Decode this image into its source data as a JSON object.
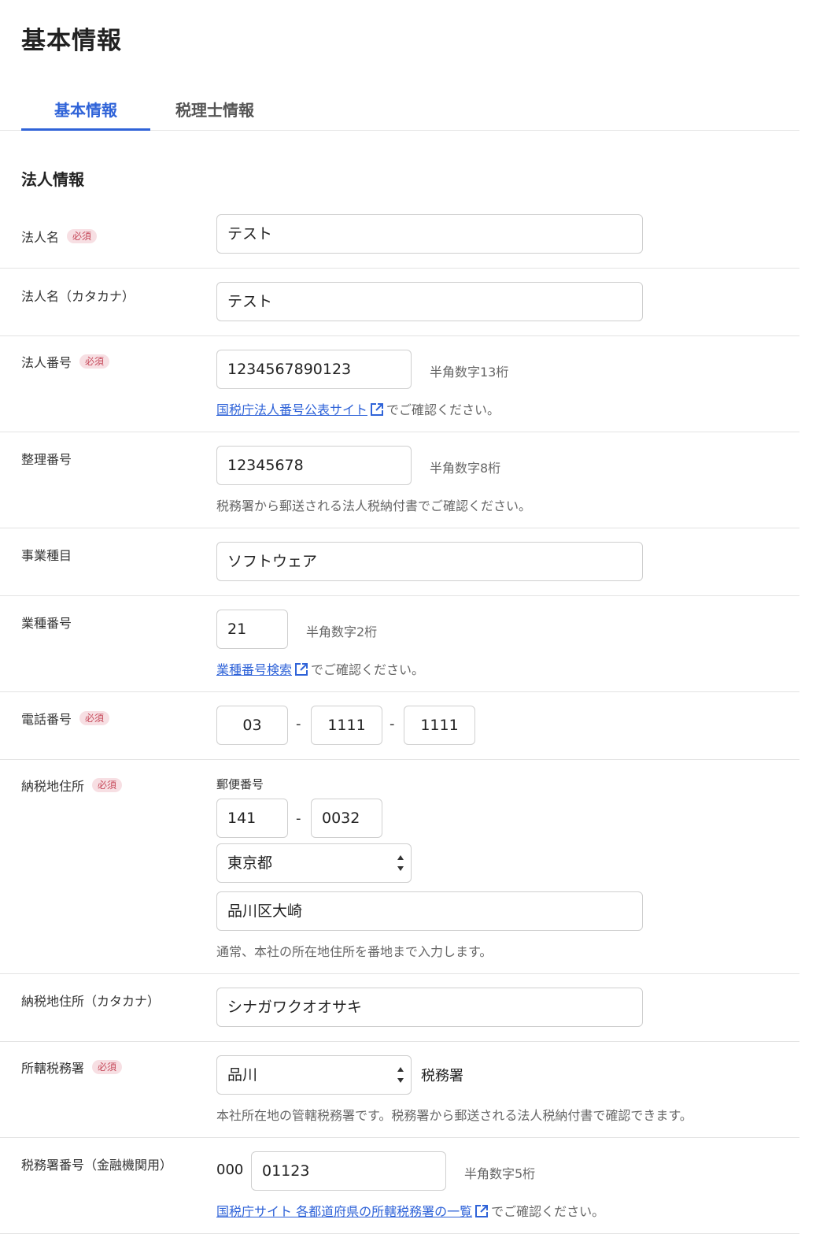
{
  "page": {
    "title": "基本情報"
  },
  "tabs": [
    {
      "label": "基本情報",
      "active": true
    },
    {
      "label": "税理士情報",
      "active": false
    }
  ],
  "section": {
    "title": "法人情報"
  },
  "required_badge": "必須",
  "fields": {
    "corp_name": {
      "label": "法人名",
      "value": "テスト"
    },
    "corp_name_kana": {
      "label": "法人名（カタカナ）",
      "value": "テスト"
    },
    "corp_number": {
      "label": "法人番号",
      "value": "1234567890123",
      "hint": "半角数字13桁",
      "note_link": "国税庁法人番号公表サイト",
      "note_text": "でご確認ください。"
    },
    "ref_number": {
      "label": "整理番号",
      "value": "12345678",
      "hint": "半角数字8桁",
      "note": "税務署から郵送される法人税納付書でご確認ください。"
    },
    "business_type": {
      "label": "事業種目",
      "value": "ソフトウェア"
    },
    "industry_code": {
      "label": "業種番号",
      "value": "21",
      "hint": "半角数字2桁",
      "note_link": "業種番号検索",
      "note_text": "でご確認ください。"
    },
    "phone": {
      "label": "電話番号",
      "part1": "03",
      "part2": "1111",
      "part3": "1111",
      "separator": "-"
    },
    "address": {
      "label": "納税地住所",
      "postal_label": "郵便番号",
      "postal1": "141",
      "postal2": "0032",
      "prefecture": "東京都",
      "city": "品川区大崎",
      "note": "通常、本社の所在地住所を番地まで入力します。"
    },
    "address_kana": {
      "label": "納税地住所（カタカナ）",
      "value": "シナガワクオオサキ"
    },
    "tax_office": {
      "label": "所轄税務署",
      "value": "品川",
      "suffix": "税務署",
      "note": "本社所在地の管轄税務署です。税務署から郵送される法人税納付書で確認できます。"
    },
    "tax_office_number": {
      "label": "税務署番号（金融機関用）",
      "prefix": "000",
      "value": "01123",
      "hint": "半角数字5桁",
      "note_link": "国税庁サイト 各都道府県の所轄税務署の一覧",
      "note_text": "でご確認ください。"
    }
  }
}
